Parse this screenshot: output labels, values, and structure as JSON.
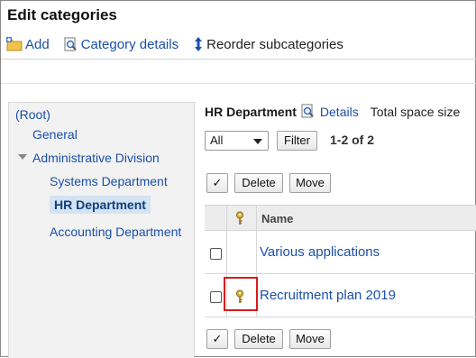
{
  "title": "Edit categories",
  "toolbar": {
    "add": "Add",
    "category_details": "Category details",
    "reorder": "Reorder subcategories"
  },
  "tree": {
    "root": "(Root)",
    "items": [
      "General",
      "Administrative Division",
      "Systems Department",
      "HR Department",
      "Accounting Department"
    ],
    "selected": "HR Department"
  },
  "main": {
    "department": "HR Department",
    "details": "Details",
    "total_space": "Total space size",
    "filter_value": "All",
    "filter_button": "Filter",
    "page_count": "1-2 of 2",
    "actions": {
      "check": "✓",
      "delete": "Delete",
      "move": "Move"
    },
    "table": {
      "name_header": "Name",
      "rows": [
        {
          "name": "Various applications",
          "key_icon": false
        },
        {
          "name": "Recruitment plan 2019",
          "key_icon": true
        }
      ]
    }
  },
  "colors": {
    "link": "#1a4fa8",
    "highlight": "#d41c1c",
    "selected_bg": "#d3e3f2",
    "key": "#c9a22a"
  }
}
